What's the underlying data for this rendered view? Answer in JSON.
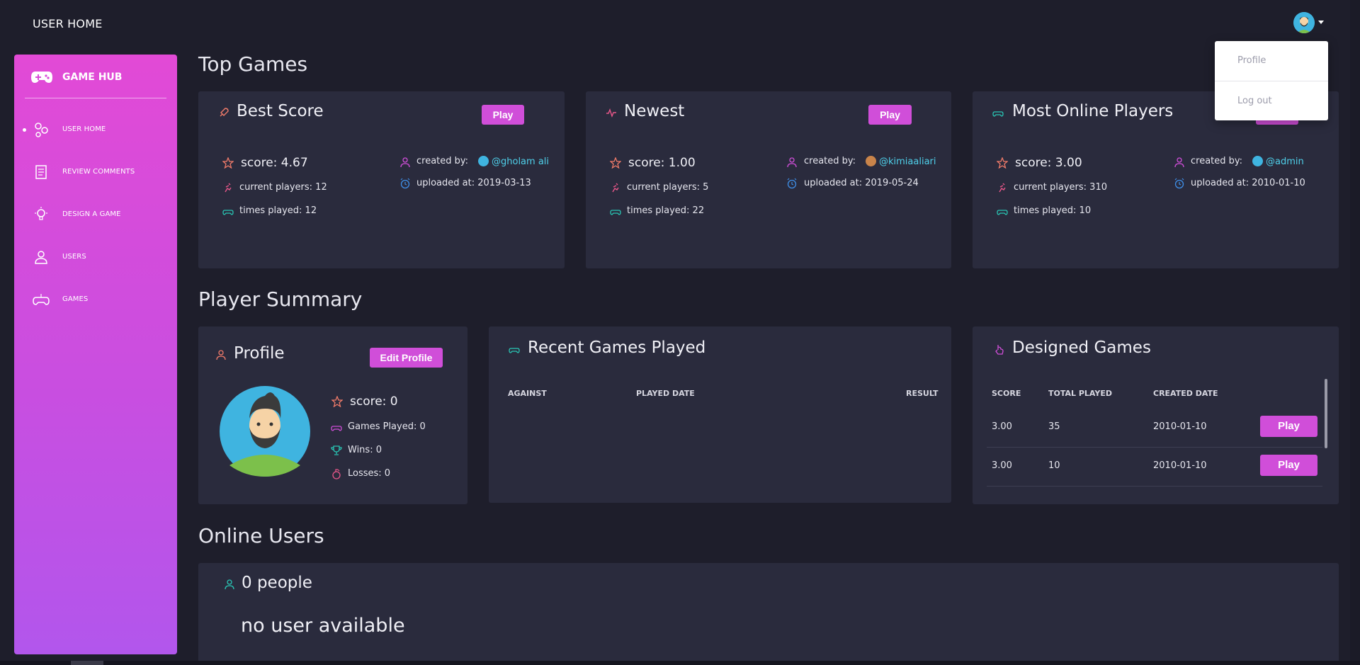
{
  "header": {
    "title": "USER HOME"
  },
  "user_menu": {
    "items": [
      "Profile",
      "Log out"
    ]
  },
  "sidebar": {
    "brand": "GAME HUB",
    "items": [
      {
        "label": "USER HOME",
        "icon": "molecule-icon",
        "active": true
      },
      {
        "label": "REVIEW COMMENTS",
        "icon": "document-icon",
        "active": false
      },
      {
        "label": "DESIGN A GAME",
        "icon": "lightbulb-icon",
        "active": false
      },
      {
        "label": "USERS",
        "icon": "user-icon",
        "active": false
      },
      {
        "label": "GAMES",
        "icon": "gamepad-icon",
        "active": false
      }
    ]
  },
  "top_games": {
    "title": "Top Games",
    "cards": [
      {
        "title": "Best Score",
        "play": "Play",
        "score": "score: 4.67",
        "current_players": "current players: 12",
        "times_played": "times played: 12",
        "created_by_label": "created by:",
        "creator": "@gholam ali",
        "uploaded": "uploaded at: 2019-03-13"
      },
      {
        "title": "Newest",
        "play": "Play",
        "score": "score: 1.00",
        "current_players": "current players: 5",
        "times_played": "times played: 22",
        "created_by_label": "created by:",
        "creator": "@kimiaaliari",
        "uploaded": "uploaded at: 2019-05-24"
      },
      {
        "title": "Most Online Players",
        "play": "Play",
        "score": "score: 3.00",
        "current_players": "current players: 310",
        "times_played": "times played: 10",
        "created_by_label": "created by:",
        "creator": "@admin",
        "uploaded": "uploaded at: 2010-01-10"
      }
    ]
  },
  "player_summary": {
    "title": "Player Summary",
    "profile": {
      "title": "Profile",
      "edit": "Edit Profile",
      "score": "score: 0",
      "games_played": "Games Played: 0",
      "wins": "Wins: 0",
      "losses": "Losses: 0"
    },
    "recent": {
      "title": "Recent Games Played",
      "columns": [
        "AGAINST",
        "PLAYED DATE",
        "RESULT"
      ]
    },
    "designed": {
      "title": "Designed Games",
      "columns": [
        "SCORE",
        "TOTAL PLAYED",
        "CREATED DATE"
      ],
      "rows": [
        {
          "score": "3.00",
          "total": "35",
          "date": "2010-01-10",
          "play": "Play"
        },
        {
          "score": "3.00",
          "total": "10",
          "date": "2010-01-10",
          "play": "Play"
        }
      ]
    }
  },
  "online_users": {
    "title": "Online Users",
    "count": "0 people",
    "empty": "no user available"
  },
  "colors": {
    "accent": "#d04ed9",
    "background": "#1e1e2b",
    "card": "#2a2b3d",
    "link": "#4fd0ea"
  }
}
